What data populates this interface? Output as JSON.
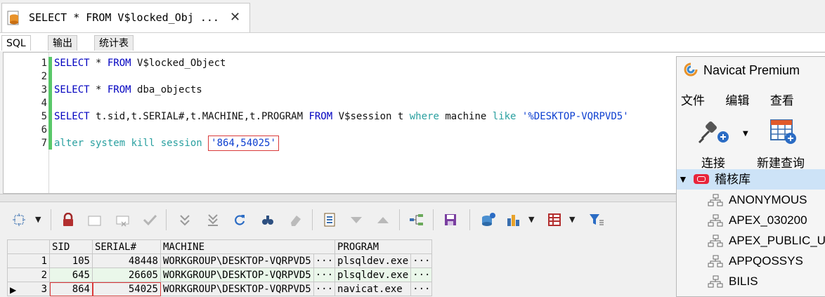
{
  "tab": {
    "title": "SELECT * FROM V$locked_Obj ...",
    "close": "✕"
  },
  "subtabs": [
    "SQL",
    "输出",
    "统计表"
  ],
  "editor": {
    "line_numbers": [
      "1",
      "2",
      "3",
      "4",
      "5",
      "6",
      "7"
    ],
    "lines": [
      {
        "parts": [
          [
            "kw",
            "SELECT"
          ],
          [
            "tx",
            " * "
          ],
          [
            "kw",
            "FROM"
          ],
          [
            "tx",
            " V$locked_Object"
          ]
        ]
      },
      {
        "parts": []
      },
      {
        "parts": [
          [
            "kw",
            "SELECT"
          ],
          [
            "tx",
            " * "
          ],
          [
            "kw",
            "FROM"
          ],
          [
            "tx",
            " dba_objects"
          ]
        ]
      },
      {
        "parts": []
      },
      {
        "parts": [
          [
            "kw",
            "SELECT"
          ],
          [
            "tx",
            " t.sid,t.SERIAL#,t.MACHINE,t.PROGRAM "
          ],
          [
            "kw",
            "FROM"
          ],
          [
            "tx",
            " V$session t "
          ],
          [
            "kw2",
            "where"
          ],
          [
            "tx",
            " machine "
          ],
          [
            "kw2",
            "like"
          ],
          [
            "tx",
            " "
          ],
          [
            "str",
            "'%DESKTOP-VQRPVD5'"
          ]
        ]
      },
      {
        "parts": []
      },
      {
        "parts": [
          [
            "kw2",
            "alter system kill session"
          ],
          [
            "tx",
            " "
          ],
          [
            "strbox",
            "'864,54025'"
          ]
        ]
      }
    ]
  },
  "grid": {
    "columns": [
      "SID",
      "SERIAL#",
      "MACHINE",
      "PROGRAM"
    ],
    "rows": [
      {
        "n": "1",
        "sid": "105",
        "serial": "48448",
        "machine": "WORKGROUP\\DESKTOP-VQRPVD5",
        "program": "plsqldev.exe"
      },
      {
        "n": "2",
        "sid": "645",
        "serial": "26605",
        "machine": "WORKGROUP\\DESKTOP-VQRPVD5",
        "program": "plsqldev.exe"
      },
      {
        "n": "3",
        "sid": "864",
        "serial": "54025",
        "machine": "WORKGROUP\\DESKTOP-VQRPVD5",
        "program": "navicat.exe"
      }
    ],
    "ellipsis": "···"
  },
  "navicat": {
    "title": "Navicat Premium",
    "menu": [
      "文件",
      "编辑",
      "查看"
    ],
    "connect_label": "连接",
    "new_query_label": "新建查询",
    "connection": "稽核库",
    "schemas": [
      "ANONYMOUS",
      "APEX_030200",
      "APEX_PUBLIC_USER",
      "APPQOSSYS",
      "BILIS"
    ]
  },
  "colors": {
    "keyword": "#0000c0",
    "keyword2": "#2aa0a0",
    "string": "#0d3fd0",
    "highlight": "#d93a3a",
    "connection": "#e8243a"
  }
}
